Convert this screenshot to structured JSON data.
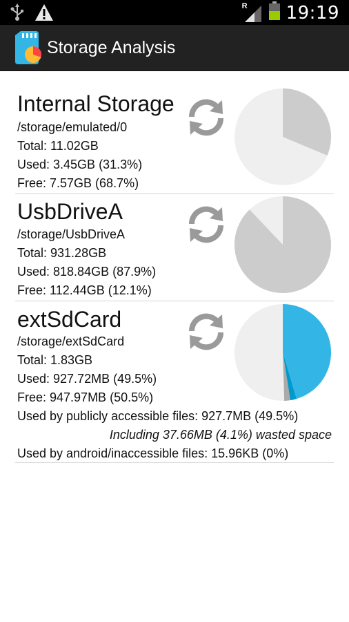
{
  "status_bar": {
    "time": "19:19",
    "roaming_indicator": "R",
    "icons": [
      "usb-icon",
      "warning-icon",
      "signal-icon",
      "battery-icon"
    ]
  },
  "action_bar": {
    "title": "Storage Analysis",
    "icon": "sd-card-pie-icon"
  },
  "colors": {
    "pie_used": "#cccccc",
    "pie_free": "#efefef",
    "pie_public": "#33b5e5",
    "pie_wasted": "#0099cc",
    "pie_android": "#aaaaaa"
  },
  "storages": [
    {
      "name": "Internal Storage",
      "path": "/storage/emulated/0",
      "total": "Total: 11.02GB",
      "used": "Used: 3.45GB (31.3%)",
      "free": "Free: 7.57GB (68.7%)",
      "used_fraction": 0.313
    },
    {
      "name": "UsbDriveA",
      "path": "/storage/UsbDriveA",
      "total": "Total: 931.28GB",
      "used": "Used: 818.84GB (87.9%)",
      "free": "Free: 112.44GB (12.1%)",
      "used_fraction": 0.879
    },
    {
      "name": "extSdCard",
      "path": "/storage/extSdCard",
      "total": "Total: 1.83GB",
      "used": "Used: 927.72MB (49.5%)",
      "free": "Free: 947.97MB (50.5%)",
      "public_files": "Used by publicly accessible files: 927.7MB (49.5%)",
      "wasted": "Including 37.66MB (4.1%) wasted space",
      "android_files": "Used by android/inaccessible files: 15.96KB (0%)",
      "public_fraction": 0.454,
      "wasted_fraction": 0.021,
      "android_fraction": 0.02
    }
  ]
}
